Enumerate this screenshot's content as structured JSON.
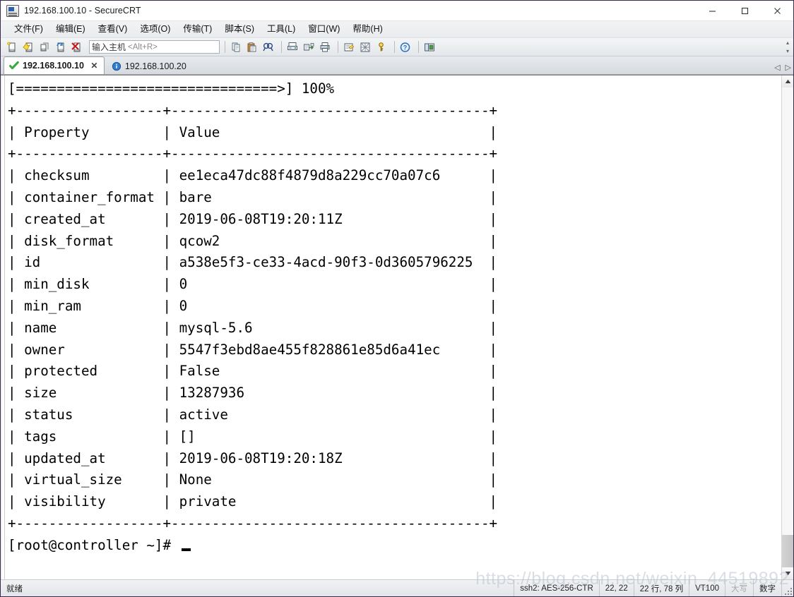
{
  "window": {
    "title": "192.168.100.10 - SecureCRT",
    "app_icon": "securecrt-icon",
    "minimize": "—",
    "maximize": "☐",
    "close": "✕"
  },
  "menubar": {
    "items": [
      {
        "name": "file",
        "label": "文件(F)",
        "text": "文件",
        "key": "F"
      },
      {
        "name": "edit",
        "label": "编辑(E)",
        "text": "编辑",
        "key": "E"
      },
      {
        "name": "view",
        "label": "查看(V)",
        "text": "查看",
        "key": "V"
      },
      {
        "name": "options",
        "label": "选项(O)",
        "text": "选项",
        "key": "O"
      },
      {
        "name": "transfer",
        "label": "传输(T)",
        "text": "传输",
        "key": "T"
      },
      {
        "name": "script",
        "label": "脚本(S)",
        "text": "脚本",
        "key": "S"
      },
      {
        "name": "tools",
        "label": "工具(L)",
        "text": "工具",
        "key": "L"
      },
      {
        "name": "window",
        "label": "窗口(W)",
        "text": "窗口",
        "key": "W"
      },
      {
        "name": "help",
        "label": "帮助(H)",
        "text": "帮助",
        "key": "H"
      }
    ]
  },
  "toolbar": {
    "icons_group1": [
      "new-session-icon",
      "quick-connect-icon",
      "clone-session-icon",
      "reconnect-icon",
      "disconnect-icon"
    ],
    "host_field": {
      "placeholder_main": "输入主机",
      "placeholder_hint": "<Alt+R>",
      "value": ""
    },
    "icons_group2": [
      "copy-icon",
      "paste-icon",
      "find-icon"
    ],
    "icons_group3": [
      "print-screen-icon",
      "log-session-icon",
      "print-icon"
    ],
    "icons_group4": [
      "session-options-icon",
      "global-options-icon",
      "key-icon"
    ],
    "icons_group5": [
      "help-icon"
    ],
    "icons_group6": [
      "session-manager-icon"
    ]
  },
  "tabs": {
    "items": [
      {
        "label": "192.168.100.10",
        "icon": "connected-check-icon",
        "active": true,
        "closable": true
      },
      {
        "label": "192.168.100.20",
        "icon": "info-circle-icon",
        "active": false,
        "closable": false
      }
    ],
    "scroll_left": "◁",
    "scroll_right": "▷"
  },
  "terminal": {
    "progress_bar": "[================================>] 100%",
    "table": {
      "rule": "+-------------------+--------------------------------------+",
      "headers": [
        "Property",
        "Value"
      ],
      "rows": [
        {
          "property": "checksum",
          "value": "ee1eca47dc88f4879d8a229cc70a07c6"
        },
        {
          "property": "container_format",
          "value": "bare"
        },
        {
          "property": "created_at",
          "value": "2019-06-08T19:20:11Z"
        },
        {
          "property": "disk_format",
          "value": "qcow2"
        },
        {
          "property": "id",
          "value": "a538e5f3-ce33-4acd-90f3-0d3605796225"
        },
        {
          "property": "min_disk",
          "value": "0"
        },
        {
          "property": "min_ram",
          "value": "0"
        },
        {
          "property": "name",
          "value": "mysql-5.6"
        },
        {
          "property": "owner",
          "value": "5547f3ebd8ae455f828861e85d6a41ec"
        },
        {
          "property": "protected",
          "value": "False"
        },
        {
          "property": "size",
          "value": "13287936"
        },
        {
          "property": "status",
          "value": "active"
        },
        {
          "property": "tags",
          "value": "[]"
        },
        {
          "property": "updated_at",
          "value": "2019-06-08T19:20:18Z"
        },
        {
          "property": "virtual_size",
          "value": "None"
        },
        {
          "property": "visibility",
          "value": "private"
        }
      ]
    },
    "prompt": "[root@controller ~]#",
    "cursor": "_"
  },
  "scrollbar": {
    "up_arrow": "▲",
    "down_arrow": "▼"
  },
  "statusbar": {
    "ready": "就绪",
    "cipher": "ssh2: AES-256-CTR",
    "cursor_pos": "22, 22",
    "dimensions": "22 行, 78 列",
    "emulation": "VT100",
    "caps": "大写",
    "num": "数字"
  },
  "watermark": "https://blog.csdn.net/weixin_44519892",
  "colors": {
    "terminal_bg": "#ffffff",
    "terminal_fg": "#000000",
    "tab_active_bg": "#ffffff",
    "chrome_bg": "#e9ecef",
    "accent": "#2f5fa8",
    "close_hover": "#e81123"
  }
}
